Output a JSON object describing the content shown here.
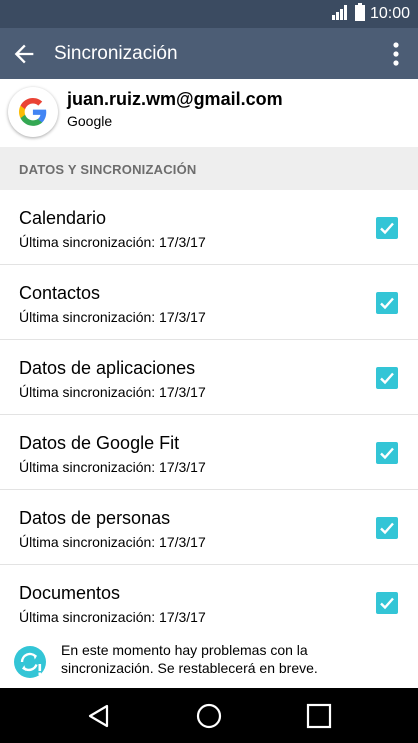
{
  "status_bar": {
    "time": "10:00"
  },
  "app_bar": {
    "title": "Sincronización"
  },
  "account": {
    "email": "juan.ruiz.wm@gmail.com",
    "type": "Google"
  },
  "section": {
    "title": "DATOS Y SINCRONIZACIÓN"
  },
  "items": [
    {
      "title": "Calendario",
      "subtitle": "Última sincronización: 17/3/17",
      "checked": true
    },
    {
      "title": "Contactos",
      "subtitle": "Última sincronización: 17/3/17",
      "checked": true
    },
    {
      "title": "Datos de aplicaciones",
      "subtitle": "Última sincronización: 17/3/17",
      "checked": true
    },
    {
      "title": "Datos de Google Fit",
      "subtitle": "Última sincronización: 17/3/17",
      "checked": true
    },
    {
      "title": "Datos de personas",
      "subtitle": "Última sincronización: 17/3/17",
      "checked": true
    },
    {
      "title": "Documentos",
      "subtitle": "Última sincronización: 17/3/17",
      "checked": true
    }
  ],
  "notice": {
    "text": "En este momento hay problemas con la sincronización. Se restablecerá en breve."
  },
  "colors": {
    "app_bar": "#4c5d75",
    "status_bar": "#3b4b61",
    "accent": "#33c5d6"
  }
}
